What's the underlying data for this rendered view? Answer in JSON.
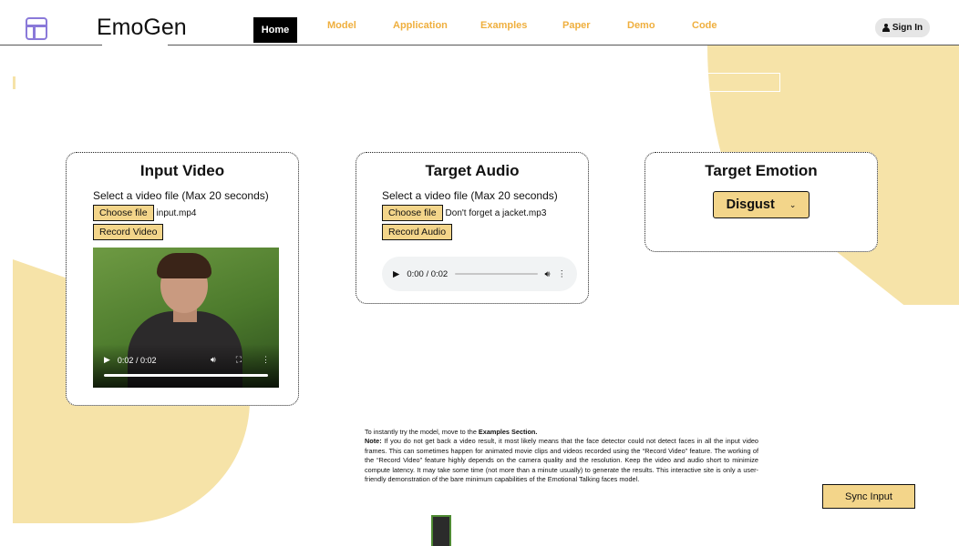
{
  "brand": {
    "name": "EmoGen",
    "logo_icon": "layout-icon"
  },
  "nav": {
    "items": [
      "Home",
      "Model",
      "Application",
      "Examples",
      "Paper",
      "Demo",
      "Code"
    ],
    "active": "Home",
    "sign_in": "Sign In"
  },
  "input_video": {
    "title": "Input Video",
    "hint": "Select a video file (Max 20 seconds)",
    "choose_label": "Choose file",
    "file_name": "input.mp4",
    "record_label": "Record Video",
    "player": {
      "time": "0:02 / 0:02",
      "progress": 1.0
    }
  },
  "target_audio": {
    "title": "Target Audio",
    "hint": "Select a video file (Max 20 seconds)",
    "choose_label": "Choose file",
    "file_name": "Don't forget a jacket.mp3",
    "record_label": "Record Audio",
    "player": {
      "time": "0:00 / 0:02",
      "progress": 0.0
    }
  },
  "target_emotion": {
    "title": "Target Emotion",
    "selected": "Disgust"
  },
  "note": {
    "line1_prefix": "To instantly try the model, move to the ",
    "line1_bold": "Examples Section.",
    "label": "Note:",
    "body": " If you do not get back a video result, it most likely means that the face detector could not detect faces in all the input video frames. This can sometimes happen for animated movie clips and videos recorded using the “Record Video” feature. The working of the “Record Video” feature highly depends on the camera quality and the resolution. Keep the video and audio short to minimize compute latency. It may take some time (not more than a minute usually) to generate the results. This interactive site is only a user-friendly demonstration of the bare minimum capabilities of the Emotional Talking faces model."
  },
  "sync_label": "Sync Input",
  "colors": {
    "accent_nav": "#efaf3e",
    "button_fill": "#f3d58a",
    "blob": "#f6e3a8",
    "logo": "#8a79d9"
  }
}
